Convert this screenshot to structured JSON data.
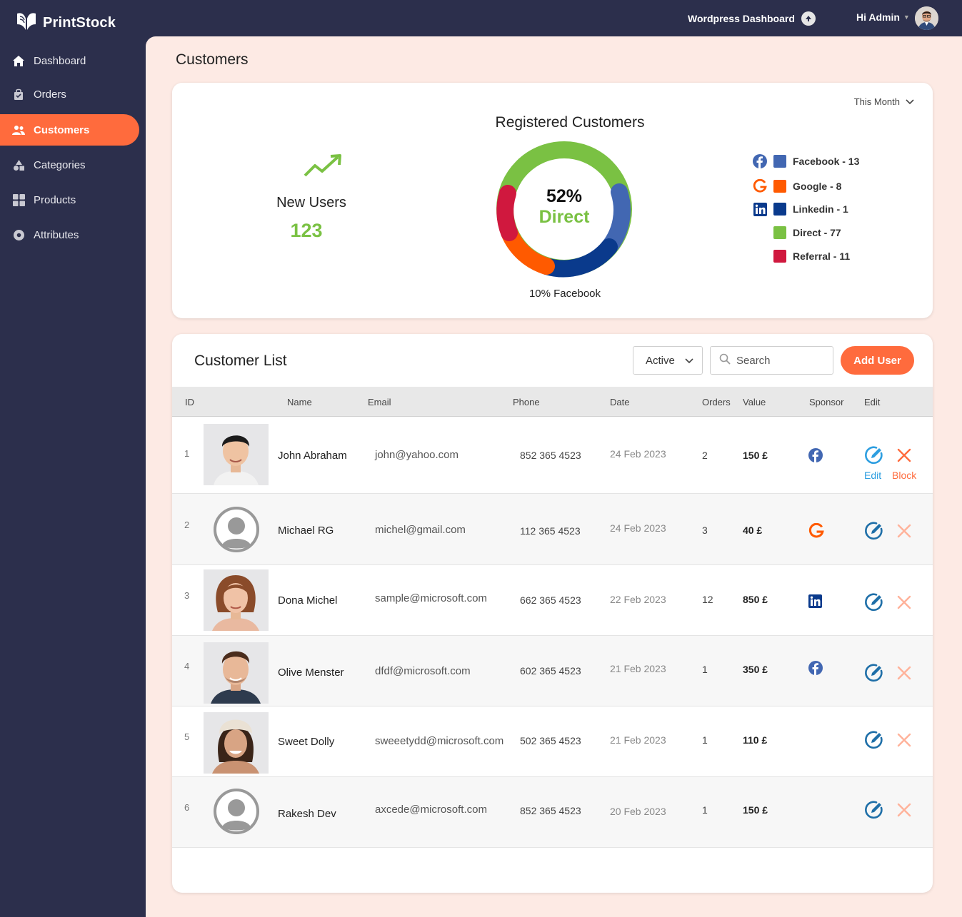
{
  "app": {
    "brand": "PrintStock"
  },
  "topbar": {
    "wp_link": "Wordpress Dashboard",
    "greeting": "Hi Admin"
  },
  "sidebar": {
    "items": [
      {
        "label": "Dashboard",
        "icon": "home-icon"
      },
      {
        "label": "Orders",
        "icon": "bag-icon"
      },
      {
        "label": "Customers",
        "icon": "users-icon",
        "active": true
      },
      {
        "label": "Categories",
        "icon": "shapes-icon"
      },
      {
        "label": "Products",
        "icon": "grid-icon"
      },
      {
        "label": "Attributes",
        "icon": "gear-icon"
      }
    ]
  },
  "page": {
    "title": "Customers"
  },
  "stats": {
    "period": "This Month",
    "new_users_label": "New Users",
    "new_users_value": "123",
    "donut_title": "Registered Customers",
    "donut_center_pct": "52%",
    "donut_center_label": "Direct",
    "donut_caption": "10% Facebook",
    "legend": [
      {
        "label": "Facebook - 13",
        "color": "#4267b2",
        "icon": "facebook-icon"
      },
      {
        "label": "Google - 8",
        "color": "#ff5a00",
        "icon": "google-icon"
      },
      {
        "label": "Linkedin - 1",
        "color": "#0a3a8c",
        "icon": "linkedin-icon"
      },
      {
        "label": "Direct - 77",
        "color": "#7ac143",
        "icon": ""
      },
      {
        "label": "Referral - 11",
        "color": "#d0183e",
        "icon": ""
      }
    ]
  },
  "list": {
    "title": "Customer List",
    "filter_value": "Active",
    "search_placeholder": "Search",
    "add_label": "Add User",
    "columns": [
      "ID",
      "Name",
      "Email",
      "Phone",
      "Date",
      "Orders",
      "Value",
      "Sponsor",
      "Edit"
    ],
    "edit_label": "Edit",
    "block_label": "Block",
    "rows": [
      {
        "id": "1",
        "name": "John Abraham",
        "email": "john@yahoo.com",
        "phone": "852 365 4523",
        "date": "24 Feb 2023",
        "orders": "2",
        "value": "150 £",
        "sponsor": "facebook-icon",
        "avatar": "photo"
      },
      {
        "id": "2",
        "name": "Michael RG",
        "email": "michel@gmail.com",
        "phone": "112 365 4523",
        "date": "24 Feb 2023",
        "orders": "3",
        "value": "40 £",
        "sponsor": "google-icon",
        "avatar": "placeholder"
      },
      {
        "id": "3",
        "name": "Dona Michel",
        "email": "sample@microsoft.com",
        "phone": "662 365 4523",
        "date": "22 Feb 2023",
        "orders": "12",
        "value": "850 £",
        "sponsor": "linkedin-icon",
        "avatar": "photo"
      },
      {
        "id": "4",
        "name": "Olive Menster",
        "email": "dfdf@microsoft.com",
        "phone": "602 365 4523",
        "date": "21 Feb 2023",
        "orders": "1",
        "value": "350 £",
        "sponsor": "facebook-icon",
        "avatar": "photo"
      },
      {
        "id": "5",
        "name": "Sweet Dolly",
        "email": "sweeetydd@microsoft.com",
        "phone": "502 365 4523",
        "date": "21 Feb 2023",
        "orders": "1",
        "value": "110 £",
        "sponsor": "",
        "avatar": "photo"
      },
      {
        "id": "6",
        "name": "Rakesh Dev",
        "email": "axcede@microsoft.com",
        "phone": "852 365 4523",
        "date": "20 Feb 2023",
        "orders": "1",
        "value": "150 £",
        "sponsor": "",
        "avatar": "placeholder"
      }
    ]
  },
  "colors": {
    "accent": "#ff6b3d",
    "sidebar": "#2c2f4c",
    "background": "#fdeae4",
    "positive": "#7ac143",
    "link": "#2d9ee0"
  }
}
